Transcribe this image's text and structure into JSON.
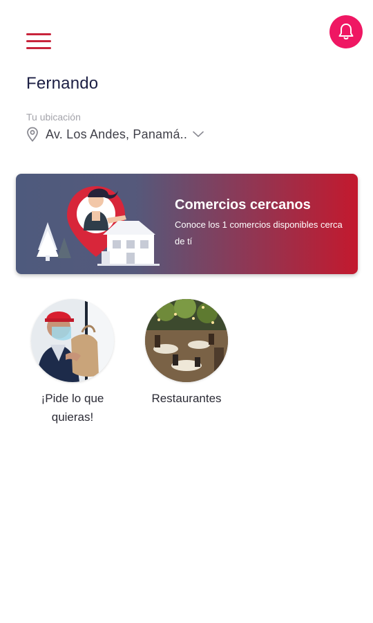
{
  "header": {
    "menu_icon": "hamburger-menu-icon",
    "notification_icon": "bell-icon",
    "accent_color": "#c8243b",
    "bell_color": "#ef1763"
  },
  "user": {
    "name": "Fernando"
  },
  "location": {
    "label": "Tu ubicación",
    "address": "Av. Los Andes, Panamá..",
    "pin_icon": "location-pin-icon",
    "dropdown_icon": "chevron-down-icon"
  },
  "banner": {
    "title": "Comercios cercanos",
    "subtitle": "Conoce los 1 comercios disponibles cerca de tí",
    "gradient_start": "#4e5a7d",
    "gradient_end": "#c3192e"
  },
  "categories": [
    {
      "label": "¡Pide lo que quieras!"
    },
    {
      "label": "Restaurantes"
    }
  ]
}
